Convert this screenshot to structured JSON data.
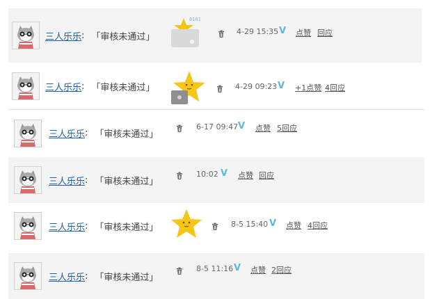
{
  "comments": [
    {
      "user": "三人乐乐",
      "colon": ":",
      "status": "「审核未通过」",
      "time": "4-29 15:35",
      "verified": "V",
      "like": "点赞",
      "reply": "回应",
      "sticker": "laptop-star-sticker",
      "sticker_text": "0101"
    },
    {
      "user": "三人乐乐",
      "colon": ":",
      "status": "「审核未通过」",
      "time": "4-29 09:23",
      "verified": "V",
      "like": "+1点赞",
      "reply": "4回应",
      "sticker": "star-with-laptop-sticker"
    },
    {
      "user": "三人乐乐",
      "colon": ":",
      "status": "「审核未通过」",
      "time": "6-17 09:47",
      "verified": "V",
      "like": "点赞",
      "reply": "5回应"
    },
    {
      "user": "三人乐乐",
      "colon": ":",
      "status": "「审核未通过」",
      "time": "10:02",
      "verified": "V",
      "like": "点赞",
      "reply": "回应"
    },
    {
      "user": "三人乐乐",
      "colon": ":",
      "status": "「审核未通过」",
      "time": "8-5 15:40",
      "verified": "V",
      "like": "点赞",
      "reply": "4回应",
      "sticker": "star-sticker"
    },
    {
      "user": "三人乐乐",
      "colon": ":",
      "status": "「审核未通过」",
      "time": "8-5 11:16",
      "verified": "V",
      "like": "点赞",
      "reply": "2回应"
    }
  ],
  "colors": {
    "link": "#1f5fa8",
    "verified": "#5bb8de",
    "row_bg": "#f4f4f4",
    "star": "#f5c518"
  }
}
